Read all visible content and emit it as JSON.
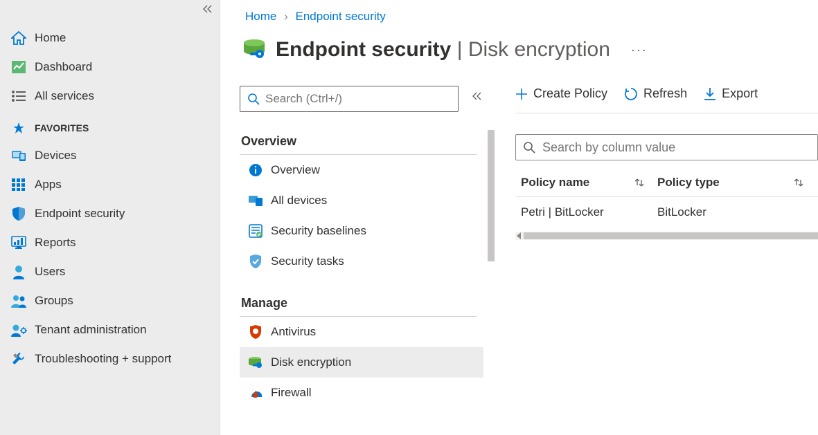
{
  "sidebar": {
    "items": [
      {
        "label": "Home",
        "icon": "home"
      },
      {
        "label": "Dashboard",
        "icon": "dashboard"
      },
      {
        "label": "All services",
        "icon": "list"
      }
    ],
    "favorites_heading": "FAVORITES",
    "favorites": [
      {
        "label": "Devices",
        "icon": "devices"
      },
      {
        "label": "Apps",
        "icon": "apps"
      },
      {
        "label": "Endpoint security",
        "icon": "endpoint"
      },
      {
        "label": "Reports",
        "icon": "reports"
      },
      {
        "label": "Users",
        "icon": "user"
      },
      {
        "label": "Groups",
        "icon": "groups"
      },
      {
        "label": "Tenant administration",
        "icon": "tenant"
      },
      {
        "label": "Troubleshooting + support",
        "icon": "wrench"
      }
    ]
  },
  "breadcrumb": {
    "items": [
      "Home",
      "Endpoint security"
    ]
  },
  "page": {
    "title_main": "Endpoint security",
    "title_sep": " | ",
    "title_sub": "Disk encryption"
  },
  "midpanel": {
    "search_placeholder": "Search (Ctrl+/)",
    "sections": {
      "overview_heading": "Overview",
      "overview_items": [
        {
          "label": "Overview",
          "icon": "info"
        },
        {
          "label": "All devices",
          "icon": "alldevices"
        },
        {
          "label": "Security baselines",
          "icon": "baselines"
        },
        {
          "label": "Security tasks",
          "icon": "tasks"
        }
      ],
      "manage_heading": "Manage",
      "manage_items": [
        {
          "label": "Antivirus",
          "icon": "antivirus"
        },
        {
          "label": "Disk encryption",
          "icon": "diskenc",
          "selected": true
        },
        {
          "label": "Firewall",
          "icon": "firewall"
        }
      ]
    }
  },
  "toolbar": {
    "create": "Create Policy",
    "refresh": "Refresh",
    "export": "Export"
  },
  "table": {
    "search_placeholder": "Search by column value",
    "columns": [
      "Policy name",
      "Policy type"
    ],
    "rows": [
      {
        "name": "Petri | BitLocker",
        "type": "BitLocker"
      }
    ]
  }
}
